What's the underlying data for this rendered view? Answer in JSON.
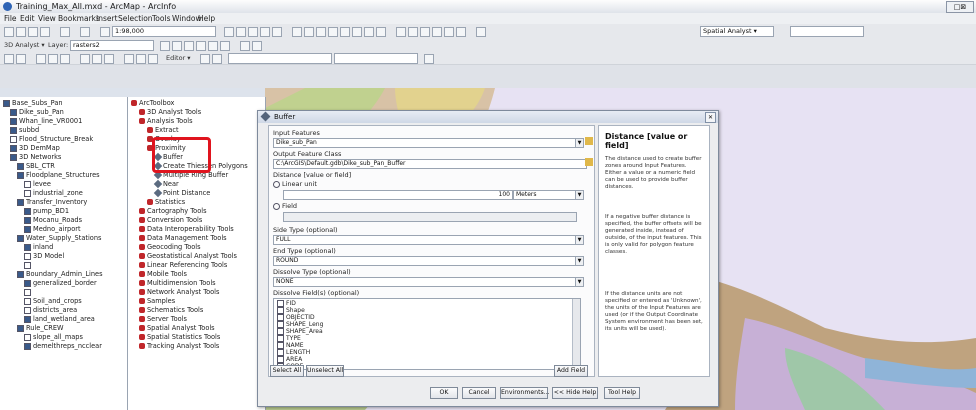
{
  "window": {
    "title": "Training_Max_All.mxd - ArcMap - ArcInfo",
    "min": "_",
    "max": "□",
    "close": "✕",
    "resize": "□⊠"
  },
  "menu": [
    "File",
    "Edit",
    "View",
    "Bookmarks",
    "Insert",
    "Selection",
    "Tools",
    "Window",
    "Help"
  ],
  "toolbar1": {
    "scale_value": "1:98,000",
    "right_combo": "Spatial Analyst ▾"
  },
  "toolbar2": {
    "analyst_label": "3D Analyst ▾",
    "layer_label": "Layer:",
    "layer_value": "rasters2"
  },
  "toolbar3": {
    "editor_label": "Editor ▾"
  },
  "toc": {
    "items": [
      {
        "label": "Base_Subs_Pan",
        "check": true,
        "indent": 0
      },
      {
        "label": "Dike_sub_Pan",
        "check": true,
        "indent": 1
      },
      {
        "label": "Whan_line_VR0001",
        "check": true,
        "indent": 1
      },
      {
        "label": "subbd",
        "check": true,
        "indent": 1
      },
      {
        "label": "Flood_Structure_Break",
        "check": false,
        "indent": 1
      },
      {
        "label": "3D DemMap",
        "check": true,
        "indent": 1
      },
      {
        "label": "3D Networks",
        "check": true,
        "indent": 1
      },
      {
        "label": "SBL_CTR",
        "check": true,
        "indent": 2
      },
      {
        "label": "Floodplane_Structures",
        "check": true,
        "indent": 2
      },
      {
        "label": "levee",
        "check": false,
        "indent": 3
      },
      {
        "label": "industrial_zone",
        "check": false,
        "indent": 3
      },
      {
        "label": "Transfer_Inventory",
        "check": true,
        "indent": 2
      },
      {
        "label": "pump_BD1",
        "check": true,
        "indent": 3
      },
      {
        "label": "Mocanu_Roads",
        "check": true,
        "indent": 3
      },
      {
        "label": "Medno_airport",
        "check": true,
        "indent": 3
      },
      {
        "label": "Water_Supply_Stations",
        "check": true,
        "indent": 2
      },
      {
        "label": "inland",
        "check": true,
        "indent": 3
      },
      {
        "label": "3D Model",
        "check": false,
        "indent": 3
      },
      {
        "label": "",
        "check": false,
        "indent": 3
      },
      {
        "label": "Boundary_Admin_Lines",
        "check": true,
        "indent": 2
      },
      {
        "label": "generalized_border",
        "check": true,
        "indent": 3
      },
      {
        "label": "",
        "check": false,
        "indent": 3
      },
      {
        "label": "Soil_and_crops",
        "check": false,
        "indent": 3
      },
      {
        "label": "districts_area",
        "check": false,
        "indent": 3
      },
      {
        "label": "land_wetland_area",
        "check": true,
        "indent": 3
      },
      {
        "label": "Rule_CREW",
        "check": true,
        "indent": 2
      },
      {
        "label": "slope_all_maps",
        "check": false,
        "indent": 3
      },
      {
        "label": "demelthreps_ncclear",
        "check": true,
        "indent": 3
      }
    ]
  },
  "toolbox": {
    "items": [
      {
        "label": "ArcToolbox",
        "kind": "root",
        "indent": 0
      },
      {
        "label": "3D Analyst Tools",
        "kind": "box",
        "indent": 1
      },
      {
        "label": "Analysis Tools",
        "kind": "box",
        "indent": 1
      },
      {
        "label": "Extract",
        "kind": "box",
        "indent": 2
      },
      {
        "label": "Overlay",
        "kind": "box",
        "indent": 2
      },
      {
        "label": "Proximity",
        "kind": "box",
        "indent": 2
      },
      {
        "label": "Buffer",
        "kind": "tool",
        "indent": 3
      },
      {
        "label": "Create Thiessen Polygons",
        "kind": "tool",
        "indent": 3
      },
      {
        "label": "Multiple Ring Buffer",
        "kind": "tool",
        "indent": 3
      },
      {
        "label": "Near",
        "kind": "tool",
        "indent": 3
      },
      {
        "label": "Point Distance",
        "kind": "tool",
        "indent": 3
      },
      {
        "label": "Statistics",
        "kind": "box",
        "indent": 2
      },
      {
        "label": "Cartography Tools",
        "kind": "box",
        "indent": 1
      },
      {
        "label": "Conversion Tools",
        "kind": "box",
        "indent": 1
      },
      {
        "label": "Data Interoperability Tools",
        "kind": "box",
        "indent": 1
      },
      {
        "label": "Data Management Tools",
        "kind": "box",
        "indent": 1
      },
      {
        "label": "Geocoding Tools",
        "kind": "box",
        "indent": 1
      },
      {
        "label": "Geostatistical Analyst Tools",
        "kind": "box",
        "indent": 1
      },
      {
        "label": "Linear Referencing Tools",
        "kind": "box",
        "indent": 1
      },
      {
        "label": "Mobile Tools",
        "kind": "box",
        "indent": 1
      },
      {
        "label": "Multidimension Tools",
        "kind": "box",
        "indent": 1
      },
      {
        "label": "Network Analyst Tools",
        "kind": "box",
        "indent": 1
      },
      {
        "label": "Samples",
        "kind": "box",
        "indent": 1
      },
      {
        "label": "Schematics Tools",
        "kind": "box",
        "indent": 1
      },
      {
        "label": "Server Tools",
        "kind": "box",
        "indent": 1
      },
      {
        "label": "Spatial Analyst Tools",
        "kind": "box",
        "indent": 1
      },
      {
        "label": "Spatial Statistics Tools",
        "kind": "box",
        "indent": 1
      },
      {
        "label": "Tracking Analyst Tools",
        "kind": "box",
        "indent": 1
      }
    ]
  },
  "dialog": {
    "title": "Buffer",
    "input_label": "Input Features",
    "input_value": "Dike_sub_Pan",
    "output_label": "Output Feature Class",
    "output_value": "C:\\ArcGIS\\Default.gdb\\Dike_sub_Pan_Buffer",
    "distance_label": "Distance [value or field]",
    "linear_unit_label": "Linear unit",
    "distance_value": "100",
    "units_value": "Meters",
    "field_label": "Field",
    "side_label": "Side Type (optional)",
    "side_value": "FULL",
    "end_label": "End Type (optional)",
    "end_value": "ROUND",
    "dissolve_label": "Dissolve Type (optional)",
    "dissolve_value": "NONE",
    "dissolve_fields_label": "Dissolve Field(s) (optional)",
    "fields": [
      "FID",
      "Shape",
      "OBJECTID",
      "SHAPE_Leng",
      "SHAPE_Area",
      "TYPE",
      "NAME",
      "LENGTH",
      "AREA",
      "CODE"
    ],
    "select_all": "Select All",
    "unselect_all": "Unselect All",
    "add_field": "Add Field",
    "buttons": {
      "ok": "OK",
      "cancel": "Cancel",
      "env": "Environments...",
      "hide": "<< Hide Help",
      "toolhelp": "Tool Help"
    },
    "help_title": "Distance [value or field]",
    "help_p1": "The distance used to create buffer zones around Input Features. Either a value or a numeric field can be used to provide buffer distances.",
    "help_p2": "If a negative buffer distance is specified, the buffer offsets will be generated inside, instead of outside, of the input features. This is only valid for polygon feature classes.",
    "help_p3": "If the distance units are not specified or entered as 'Unknown', the units of the Input Features are used (or if the Output Coordinate System environment has been set, its units will be used)."
  },
  "colors": {
    "highlight_box": "#e0141e",
    "map_base": "#e7e2f3"
  }
}
